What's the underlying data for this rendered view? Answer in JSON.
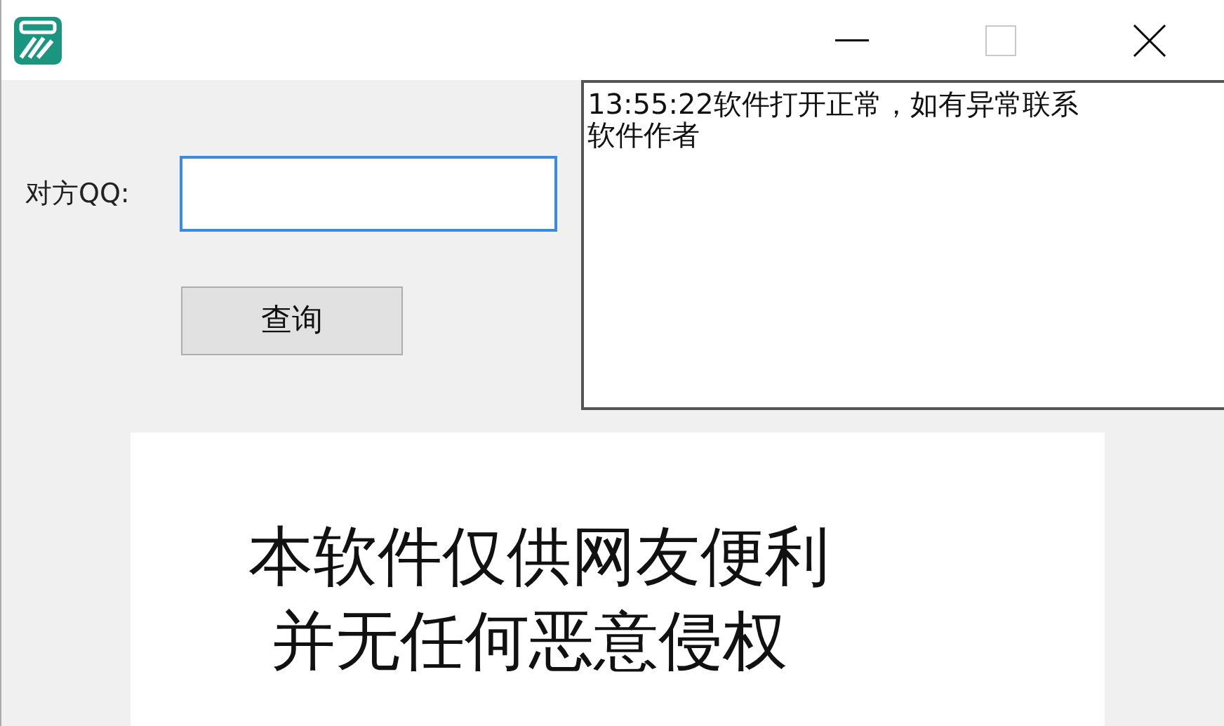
{
  "window": {
    "controls": [
      {
        "kind": "minimize",
        "disabled": false
      },
      {
        "kind": "maximize",
        "disabled": true
      },
      {
        "kind": "close",
        "disabled": false
      }
    ]
  },
  "form": {
    "label": "对方QQ:",
    "button": "查询"
  },
  "log": {
    "lines": [
      "13:55:22软件打开正常，如有异常联系",
      "软件作者"
    ]
  },
  "banner": {
    "lines": [
      "本软件仅供网友便利",
      "并无任何恶意侵权"
    ]
  }
}
